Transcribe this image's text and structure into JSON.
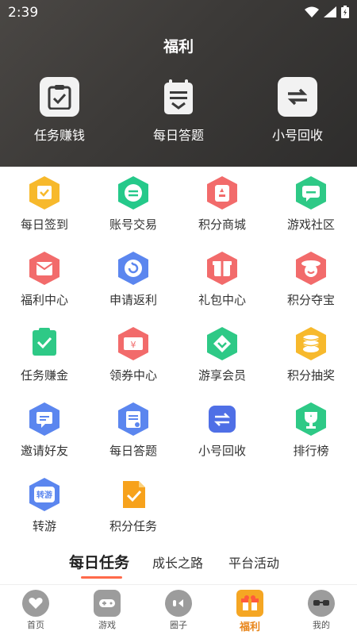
{
  "status_bar": {
    "time": "2:39"
  },
  "header": {
    "title": "福利"
  },
  "top_actions": [
    {
      "label": "任务赚钱",
      "icon": "task-clipboard-icon"
    },
    {
      "label": "每日答题",
      "icon": "quiz-clipboard-icon"
    },
    {
      "label": "小号回收",
      "icon": "exchange-arrows-icon"
    }
  ],
  "grid": [
    {
      "label": "每日签到",
      "icon": "checkin-calendar-icon",
      "color": "#f7b92c"
    },
    {
      "label": "账号交易",
      "icon": "trade-arrows-icon",
      "color": "#25c98a"
    },
    {
      "label": "积分商城",
      "icon": "points-shop-icon",
      "color": "#f26b6b"
    },
    {
      "label": "游戏社区",
      "icon": "chat-bubble-icon",
      "color": "#2ec986"
    },
    {
      "label": "福利中心",
      "icon": "welfare-envelope-icon",
      "color": "#f26b6b"
    },
    {
      "label": "申请返利",
      "icon": "rebate-refresh-icon",
      "color": "#5b86ef"
    },
    {
      "label": "礼包中心",
      "icon": "gift-box-icon",
      "color": "#f26b6b"
    },
    {
      "label": "积分夺宝",
      "icon": "treasure-face-icon",
      "color": "#f26b6b"
    },
    {
      "label": "任务赚金",
      "icon": "task-check-icon",
      "color": "#2ec986"
    },
    {
      "label": "领券中心",
      "icon": "coupon-yen-icon",
      "color": "#f26b6b"
    },
    {
      "label": "游享会员",
      "icon": "vip-heart-icon",
      "color": "#2ec986"
    },
    {
      "label": "积分抽奖",
      "icon": "lottery-coins-icon",
      "color": "#f7b92c"
    },
    {
      "label": "邀请好友",
      "icon": "invite-message-icon",
      "color": "#5b86ef"
    },
    {
      "label": "每日答题",
      "icon": "quiz-clipboard-icon",
      "color": "#5b86ef"
    },
    {
      "label": "小号回收",
      "icon": "recycle-arrows-icon",
      "color": "#4f6fe6"
    },
    {
      "label": "排行榜",
      "icon": "ranking-trophy-icon",
      "color": "#2ec986"
    },
    {
      "label": "转游",
      "icon": "transfer-game-icon",
      "color": "#5b86ef",
      "text": "转游"
    },
    {
      "label": "积分任务",
      "icon": "points-task-icon",
      "color": "#f7a21c"
    }
  ],
  "tabs": [
    {
      "label": "每日任务",
      "active": true
    },
    {
      "label": "成长之路",
      "active": false
    },
    {
      "label": "平台活动",
      "active": false
    }
  ],
  "bottom_nav": [
    {
      "label": "首页",
      "icon": "home-heart-icon",
      "active": false
    },
    {
      "label": "游戏",
      "icon": "gamepad-icon",
      "active": false
    },
    {
      "label": "圈子",
      "icon": "circle-community-icon",
      "active": false
    },
    {
      "label": "福利",
      "icon": "welfare-gift-icon",
      "active": true,
      "color": "#f5a623"
    },
    {
      "label": "我的",
      "icon": "profile-glasses-icon",
      "active": false
    }
  ]
}
